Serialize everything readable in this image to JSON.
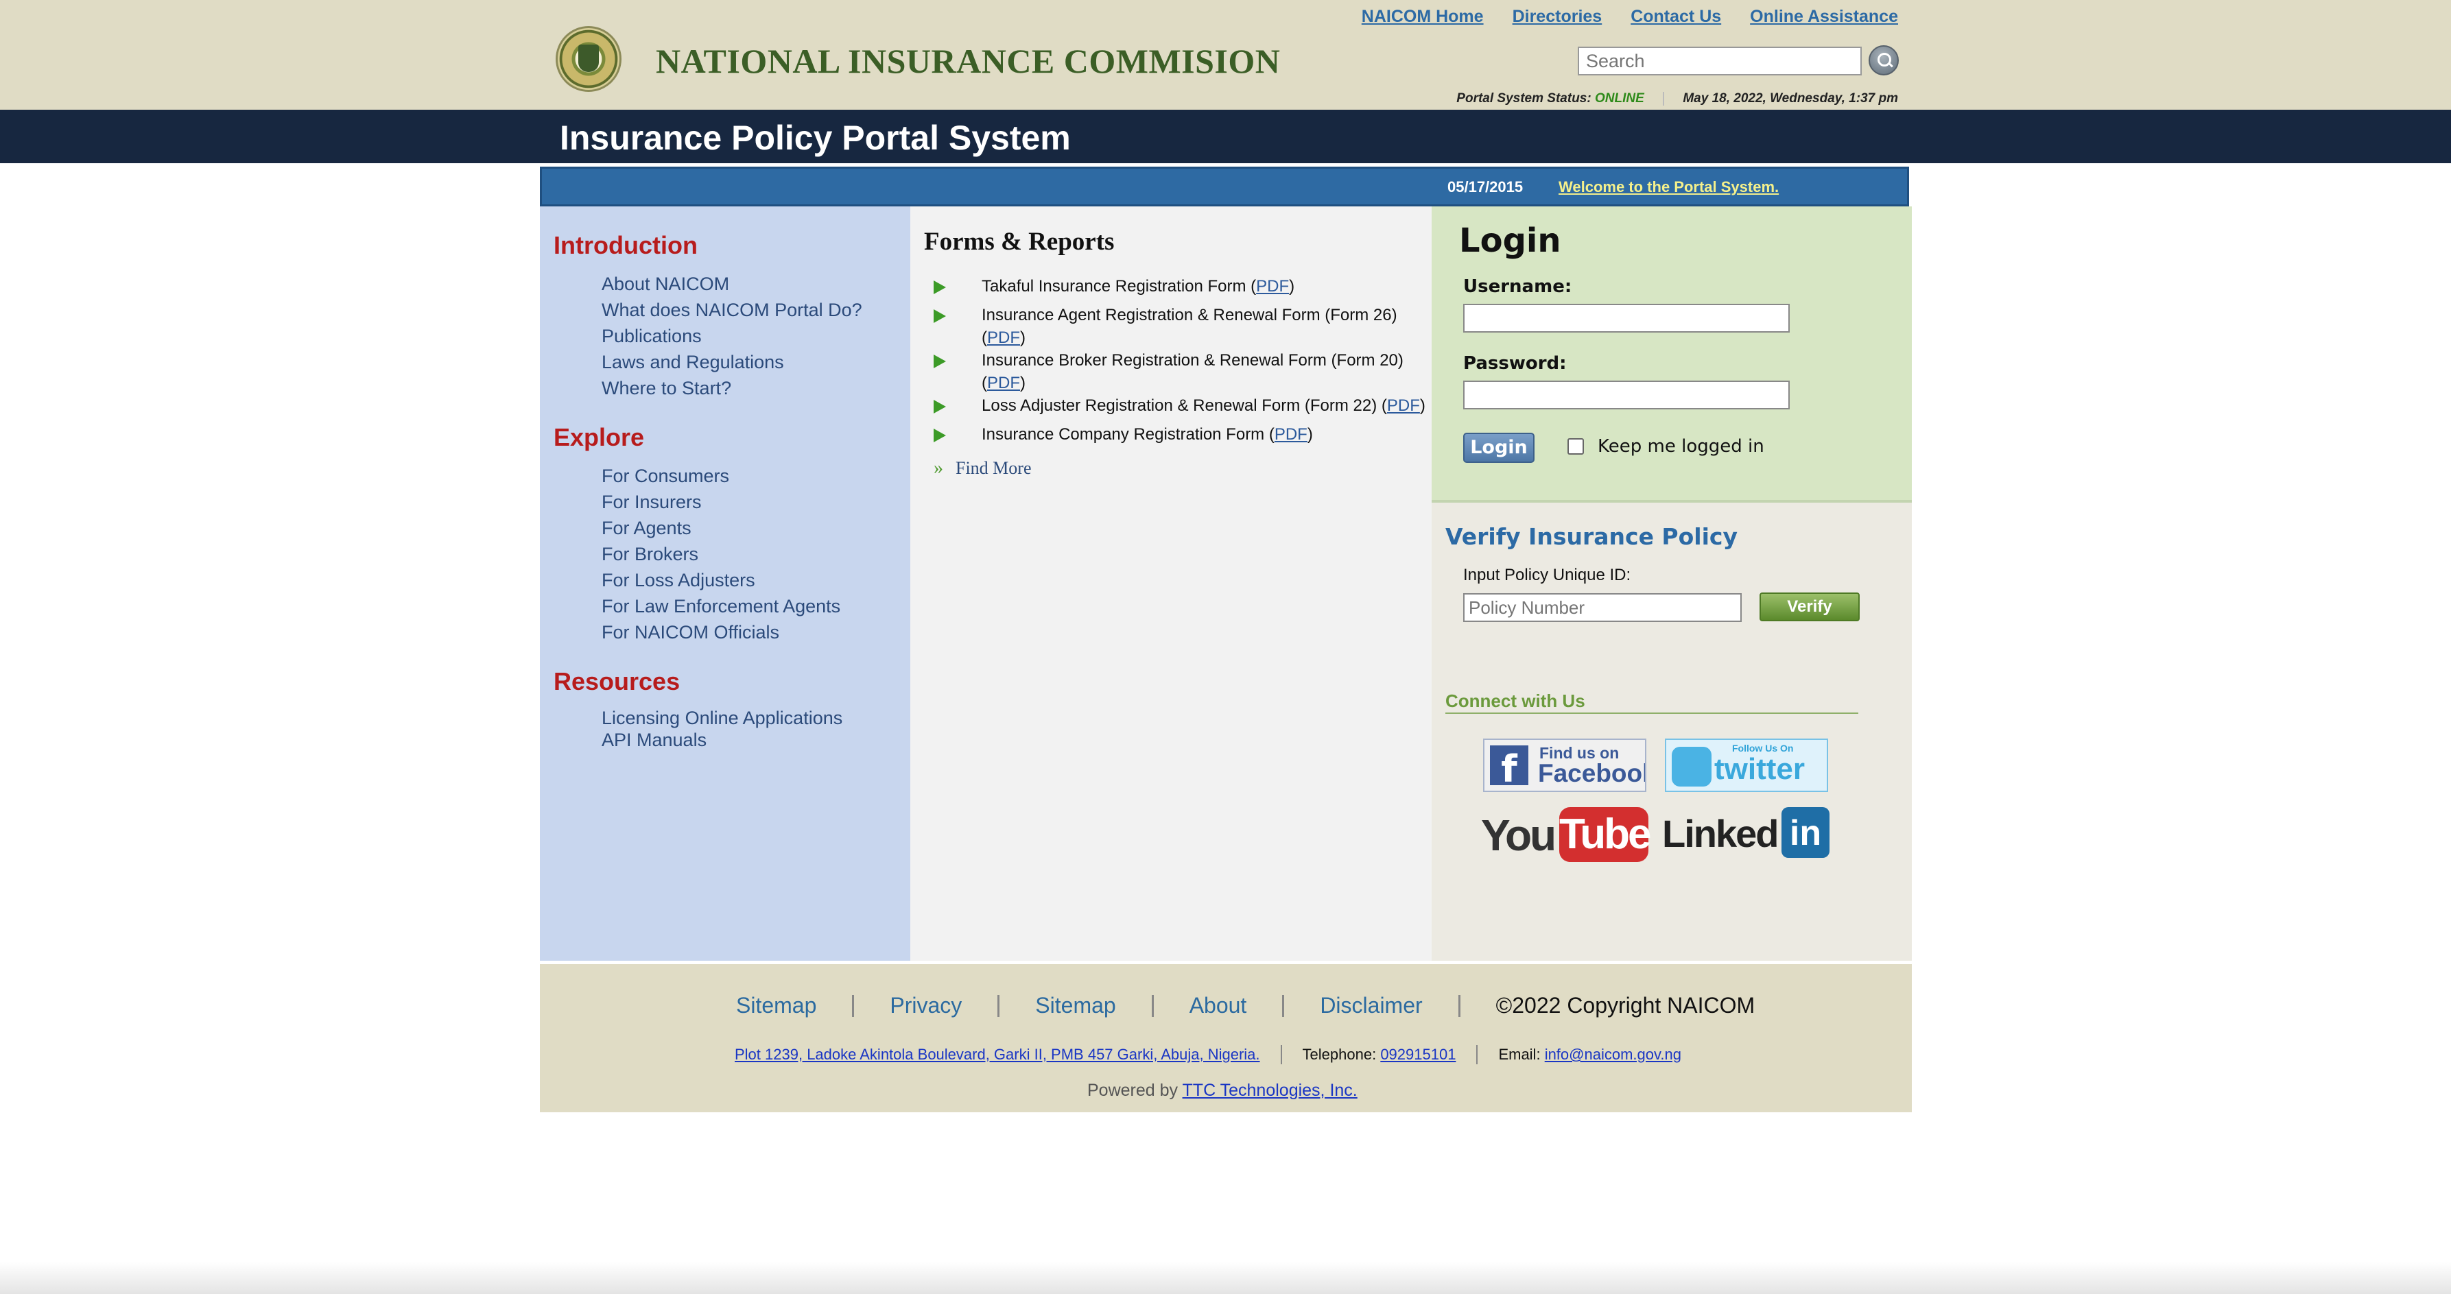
{
  "header": {
    "site_title": "NATIONAL INSURANCE COMMISION",
    "top_nav": [
      "NAICOM Home",
      "Directories",
      "Contact Us",
      "Online Assistance"
    ],
    "search_placeholder": "Search",
    "status_label": "Portal System Status:",
    "status_value": "ONLINE",
    "datetime": "May 18, 2022, Wednesday, 1:37 pm"
  },
  "banner": {
    "title": "Insurance Policy Portal System"
  },
  "welcome": {
    "date": "05/17/2015",
    "message": "Welcome to the Portal System."
  },
  "sidebar": {
    "sections": [
      {
        "title": "Introduction",
        "items": [
          "About NAICOM",
          "What does NAICOM Portal Do?",
          "Publications",
          "Laws and Regulations",
          "Where to Start?"
        ]
      },
      {
        "title": "Explore",
        "items": [
          "For Consumers",
          "For Insurers",
          "For Agents",
          "For Brokers",
          "For Loss Adjusters",
          "For Law Enforcement Agents",
          "For NAICOM Officials"
        ]
      },
      {
        "title": "Resources",
        "items": [
          "Licensing Online Applications",
          "API Manuals"
        ]
      }
    ]
  },
  "forms": {
    "title": "Forms & Reports",
    "items": [
      {
        "label": "Takaful Insurance Registration Form",
        "link": "PDF"
      },
      {
        "label": "Insurance Agent Registration & Renewal Form (Form 26)",
        "link": "PDF"
      },
      {
        "label": "Insurance Broker Registration & Renewal Form (Form 20)",
        "link": "PDF"
      },
      {
        "label": "Loss Adjuster Registration & Renewal Form (Form 22)",
        "link": "PDF"
      },
      {
        "label": "Insurance Company Registration Form",
        "link": "PDF"
      }
    ],
    "find_more": "Find More"
  },
  "login": {
    "title": "Login",
    "username_label": "Username:",
    "username_value": "",
    "password_label": "Password:",
    "password_value": "",
    "button": "Login",
    "keep_label": "Keep me logged in",
    "keep_checked": false
  },
  "verify": {
    "title": "Verify Insurance Policy",
    "label": "Input Policy Unique ID:",
    "placeholder": "Policy Number",
    "button": "Verify"
  },
  "connect": {
    "title": "Connect with Us",
    "facebook": {
      "line1": "Find us on",
      "line2": "Facebook",
      "icon": "f"
    },
    "twitter": {
      "line1": "Follow Us On",
      "line2": "twitter"
    },
    "youtube": {
      "part1": "You",
      "part2": "Tube"
    },
    "linkedin": {
      "part1": "Linked",
      "part2": "in"
    }
  },
  "footer": {
    "links": [
      "Sitemap",
      "Privacy",
      "Sitemap",
      "About",
      "Disclaimer"
    ],
    "copyright": "©2022 Copyright NAICOM",
    "address": "Plot 1239, Ladoke Akintola Boulevard, Garki II, PMB 457 Garki, Abuja, Nigeria.",
    "telephone_label": "Telephone:",
    "telephone": "092915101",
    "email_label": "Email:",
    "email": "info@naicom.gov.ng",
    "powered_label": "Powered by",
    "powered_company": "TTC Technologies, Inc."
  },
  "colors": {
    "header_bg": "#e0dcc5",
    "banner_bg": "#172740",
    "welcome_bar": "#2e6aa3",
    "sidebar_bg": "#c8d6ee",
    "section_heading": "#b71c1c",
    "login_panel": "#d7e6c4",
    "title_green": "#3b5e26"
  }
}
